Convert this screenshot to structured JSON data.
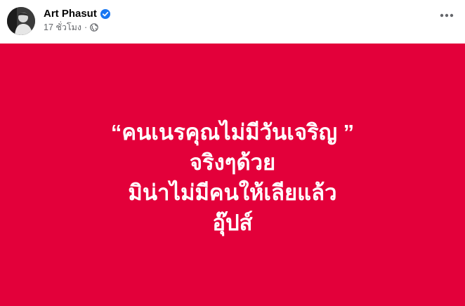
{
  "post": {
    "author": "Art Phasut",
    "verified": true,
    "time": "17 ชั่วโมง",
    "separator": "·",
    "audience_icon": "globe-icon",
    "more_icon": "more-horizontal-icon",
    "content_lines": [
      "“คนเนรคุณไม่มีวันเจริญ ”",
      "จริงๆด้วย",
      "มิน่าไม่มีคนให้เลียแล้ว",
      "อุ๊ปส์"
    ]
  },
  "colors": {
    "background_card": "#e3003a",
    "text_on_card": "#ffffff",
    "verified_badge": "#1877f2",
    "meta_text": "#65676b"
  }
}
